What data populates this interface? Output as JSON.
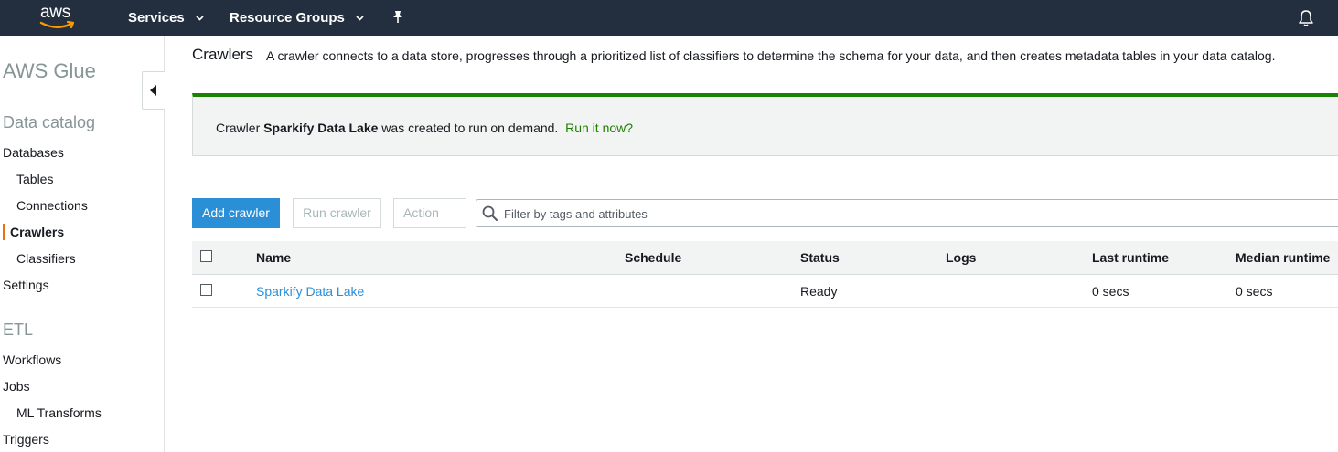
{
  "topnav": {
    "logo_text": "aws",
    "services_label": "Services",
    "resource_groups_label": "Resource Groups",
    "icons": [
      "pin-icon",
      "bell-icon"
    ],
    "background": "#232f3e"
  },
  "sidebar": {
    "service_title": "AWS Glue",
    "data_catalog_title": "Data catalog",
    "items": {
      "databases": "Databases",
      "tables": "Tables",
      "connections": "Connections",
      "crawlers": "Crawlers",
      "classifiers": "Classifiers",
      "settings": "Settings"
    },
    "etl_title": "ETL",
    "etl_items": {
      "workflows": "Workflows",
      "jobs": "Jobs",
      "ml_transforms": "ML Transforms",
      "triggers": "Triggers"
    },
    "active_item": "Crawlers",
    "accent_color": "#ec7211"
  },
  "main": {
    "title": "Crawlers",
    "description": "A crawler connects to a data store, progresses through a prioritized list of classifiers to determine the schema for your data, and then creates metadata tables in your data catalog.",
    "flash": {
      "prefix": "Crawler ",
      "crawler_name": "Sparkify Data Lake",
      "suffix": " was created to run on demand.",
      "link": "Run it now?",
      "color": "#1d8102"
    },
    "toolbar": {
      "add_label": "Add crawler",
      "run_label": "Run crawler",
      "action_label": "Action",
      "filter_placeholder": "Filter by tags and attributes"
    },
    "table": {
      "columns": {
        "name": "Name",
        "schedule": "Schedule",
        "status": "Status",
        "logs": "Logs",
        "last_runtime": "Last runtime",
        "median_runtime": "Median runtime"
      },
      "rows": [
        {
          "name": "Sparkify Data Lake",
          "schedule": "",
          "status": "Ready",
          "logs": "",
          "last_runtime": "0 secs",
          "median_runtime": "0 secs"
        }
      ]
    },
    "link_color": "#2b8fd8"
  }
}
